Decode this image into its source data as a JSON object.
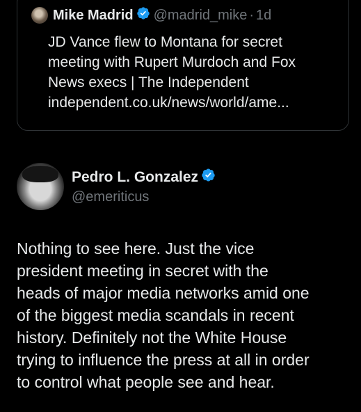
{
  "quoted_tweet": {
    "author_name": "Mike Madrid",
    "handle": "@madrid_mike",
    "separator": "·",
    "time": "1d",
    "text_lines": [
      "JD Vance flew to Montana for secret",
      "meeting with Rupert Murdoch and Fox",
      "News execs | The Independent",
      "independent.co.uk/news/world/ame..."
    ]
  },
  "tweet": {
    "author_name": "Pedro L. Gonzalez",
    "handle": "@emeriticus",
    "text_lines": [
      "Nothing to see here. Just the vice",
      "president meeting in secret with the",
      "heads of major media networks amid one",
      "of the biggest media scandals in recent",
      "history. Definitely not the White House",
      "trying to influence the press at all in order",
      "to control what people see and hear."
    ]
  },
  "colors": {
    "background": "#000000",
    "text_primary": "#e7e9ea",
    "text_secondary": "#71767b",
    "border": "#2f3336",
    "verified_badge": "#1d9bf0"
  },
  "icons": [
    "verified-badge-icon"
  ]
}
